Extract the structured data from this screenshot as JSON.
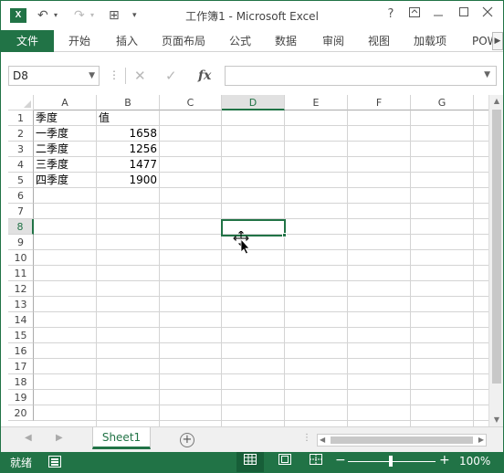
{
  "titlebar": {
    "app_icon": "X",
    "title": "工作簿1 - Microsoft Excel",
    "help": "?",
    "undo": "↶",
    "redo": "↷",
    "customize": "⊞"
  },
  "ribbon": {
    "file_label": "文件",
    "tabs": [
      "开始",
      "插入",
      "页面布局",
      "公式",
      "数据",
      "审阅",
      "视图",
      "加载项",
      "POW"
    ]
  },
  "formula_bar": {
    "name_box": "D8",
    "cancel_icon": "✕",
    "enter_icon": "✓",
    "fx_label": "fx",
    "formula": ""
  },
  "sheet": {
    "columns": [
      "A",
      "B",
      "C",
      "D",
      "E",
      "F",
      "G"
    ],
    "rows": [
      "1",
      "2",
      "3",
      "4",
      "5",
      "6",
      "7",
      "8",
      "9",
      "10",
      "11",
      "12",
      "13",
      "14",
      "15",
      "16",
      "17",
      "18",
      "19",
      "20"
    ],
    "selected_cell": "D8",
    "cells": {
      "A1": "季度",
      "B1": "值",
      "A2": "一季度",
      "B2": "1658",
      "A3": "二季度",
      "B3": "1256",
      "A4": "三季度",
      "B4": "1477",
      "A5": "四季度",
      "B5": "1900"
    }
  },
  "sheet_tabs": {
    "tabs": [
      "Sheet1"
    ],
    "add_label": "+"
  },
  "status_bar": {
    "ready": "就绪",
    "zoom": "100%",
    "zoom_minus": "−",
    "zoom_plus": "+"
  },
  "colors": {
    "accent": "#217346",
    "gridline": "#d4d4d4"
  }
}
